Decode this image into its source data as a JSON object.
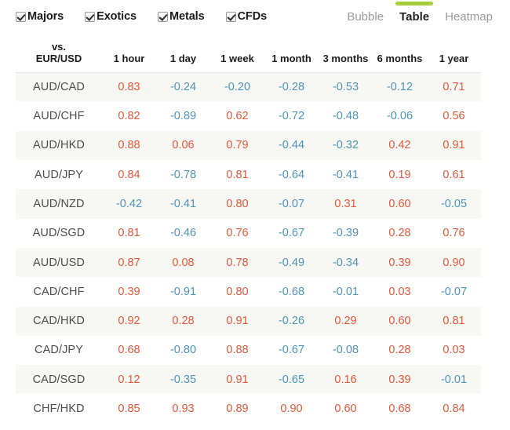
{
  "toolbar": {
    "filters": [
      {
        "label": "Majors",
        "checked": true
      },
      {
        "label": "Exotics",
        "checked": true
      },
      {
        "label": "Metals",
        "checked": true
      },
      {
        "label": "CFDs",
        "checked": true
      }
    ],
    "views": [
      {
        "label": "Bubble",
        "active": false
      },
      {
        "label": "Table",
        "active": true
      },
      {
        "label": "Heatmap",
        "active": false
      }
    ]
  },
  "colors": {
    "positive": "#e2573a",
    "negative": "#4e93b9",
    "active_tab_bar": "#a4ce3c",
    "row_stripe": "#f7f8f4"
  },
  "table": {
    "corner_line1": "vs.",
    "corner_line2": "EUR/USD",
    "columns": [
      "1 hour",
      "1 day",
      "1 week",
      "1 month",
      "3 months",
      "6 months",
      "1 year"
    ],
    "rows": [
      {
        "pair": "AUD/CAD",
        "values": [
          "0.83",
          "-0.24",
          "-0.20",
          "-0.28",
          "-0.53",
          "-0.12",
          "0.71"
        ]
      },
      {
        "pair": "AUD/CHF",
        "values": [
          "0.82",
          "-0.89",
          "0.62",
          "-0.72",
          "-0.48",
          "-0.06",
          "0.56"
        ]
      },
      {
        "pair": "AUD/HKD",
        "values": [
          "0.88",
          "0.06",
          "0.79",
          "-0.44",
          "-0.32",
          "0.42",
          "0.91"
        ]
      },
      {
        "pair": "AUD/JPY",
        "values": [
          "0.84",
          "-0.78",
          "0.81",
          "-0.64",
          "-0.41",
          "0.19",
          "0.61"
        ]
      },
      {
        "pair": "AUD/NZD",
        "values": [
          "-0.42",
          "-0.41",
          "0.80",
          "-0.07",
          "0.31",
          "0.60",
          "-0.05"
        ]
      },
      {
        "pair": "AUD/SGD",
        "values": [
          "0.81",
          "-0.46",
          "0.76",
          "-0.67",
          "-0.39",
          "0.28",
          "0.76"
        ]
      },
      {
        "pair": "AUD/USD",
        "values": [
          "0.87",
          "0.08",
          "0.78",
          "-0.49",
          "-0.34",
          "0.39",
          "0.90"
        ]
      },
      {
        "pair": "CAD/CHF",
        "values": [
          "0.39",
          "-0.91",
          "0.80",
          "-0.68",
          "-0.01",
          "0.03",
          "-0.07"
        ]
      },
      {
        "pair": "CAD/HKD",
        "values": [
          "0.92",
          "0.28",
          "0.91",
          "-0.26",
          "0.29",
          "0.60",
          "0.81"
        ]
      },
      {
        "pair": "CAD/JPY",
        "values": [
          "0.68",
          "-0.80",
          "0.88",
          "-0.67",
          "-0.08",
          "0.28",
          "0.03"
        ]
      },
      {
        "pair": "CAD/SGD",
        "values": [
          "0.12",
          "-0.35",
          "0.91",
          "-0.65",
          "0.16",
          "0.39",
          "-0.01"
        ]
      },
      {
        "pair": "CHF/HKD",
        "values": [
          "0.85",
          "0.93",
          "0.89",
          "0.90",
          "0.60",
          "0.68",
          "0.84"
        ]
      }
    ]
  }
}
